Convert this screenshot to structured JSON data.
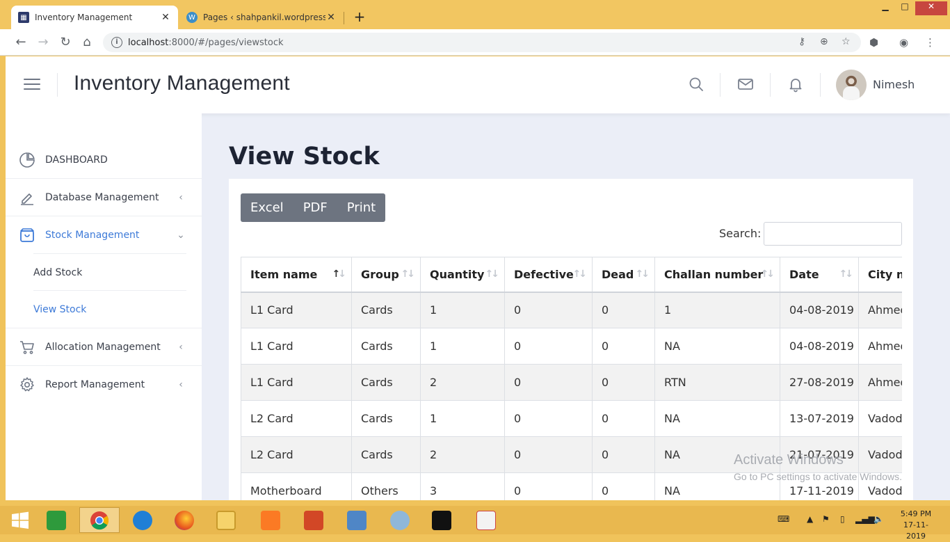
{
  "browser": {
    "tabs": [
      {
        "title": "Inventory Management",
        "active": true
      },
      {
        "title": "Pages ‹ shahpankil.wordpress.com",
        "active": false
      }
    ],
    "url_host": "localhost",
    "url_path": ":8000/#/pages/viewstock",
    "window_controls": {
      "minimize": "▁",
      "maximize": "□",
      "close": "✕"
    }
  },
  "header": {
    "title": "Inventory Management",
    "user_name": "Nimesh"
  },
  "sidebar": {
    "items": [
      {
        "label": "DASHBOARD",
        "icon": "dashboard-pie-icon",
        "chevron": ""
      },
      {
        "label": "Database Management",
        "icon": "pencil-icon",
        "chevron": "‹"
      },
      {
        "label": "Stock Management",
        "icon": "box-icon",
        "chevron": "⌄"
      },
      {
        "label": "Allocation Management",
        "icon": "cart-icon",
        "chevron": "‹"
      },
      {
        "label": "Report Management",
        "icon": "gear-icon",
        "chevron": "‹"
      }
    ],
    "sub_items": [
      {
        "label": "Add Stock"
      },
      {
        "label": "View Stock"
      }
    ]
  },
  "page": {
    "title": "View Stock",
    "export_buttons": [
      "Excel",
      "PDF",
      "Print"
    ],
    "search_label": "Search:",
    "search_value": ""
  },
  "table": {
    "columns": [
      "Item name",
      "Group",
      "Quantity",
      "Defective",
      "Dead",
      "Challan number",
      "Date",
      "City name"
    ],
    "rows": [
      [
        "L1 Card",
        "Cards",
        "1",
        "0",
        "0",
        "1",
        "04-08-2019",
        "Ahmedabad"
      ],
      [
        "L1 Card",
        "Cards",
        "1",
        "0",
        "0",
        "NA",
        "04-08-2019",
        "Ahmedabad"
      ],
      [
        "L1 Card",
        "Cards",
        "2",
        "0",
        "0",
        "RTN",
        "27-08-2019",
        "Ahmedabad"
      ],
      [
        "L2 Card",
        "Cards",
        "1",
        "0",
        "0",
        "NA",
        "13-07-2019",
        "Vadodara"
      ],
      [
        "L2 Card",
        "Cards",
        "2",
        "0",
        "0",
        "NA",
        "21-07-2019",
        "Vadodara"
      ],
      [
        "Motherboard",
        "Others",
        "3",
        "0",
        "0",
        "NA",
        "17-11-2019",
        "Vadodara"
      ]
    ]
  },
  "watermark": {
    "line1": "Activate Windows",
    "line2": "Go to PC settings to activate Windows."
  },
  "taskbar": {
    "time": "5:49 PM",
    "date": "17-11-2019"
  }
}
